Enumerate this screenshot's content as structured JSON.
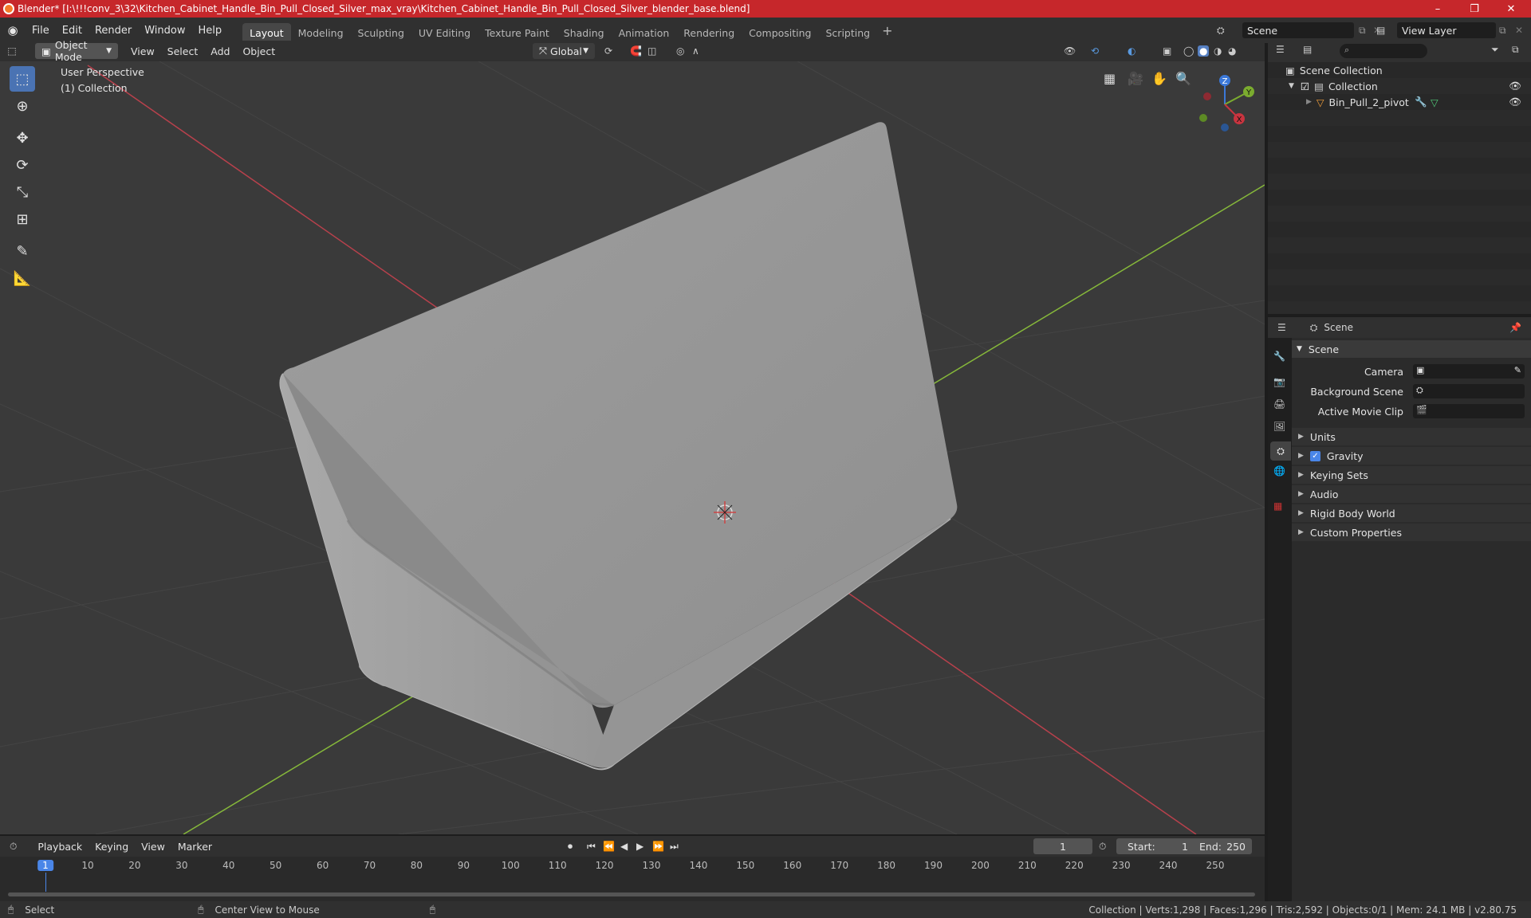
{
  "window": {
    "title": "Blender* [I:\\!!!conv_3\\32\\Kitchen_Cabinet_Handle_Bin_Pull_Closed_Silver_max_vray\\Kitchen_Cabinet_Handle_Bin_Pull_Closed_Silver_blender_base.blend]",
    "minimize": "–",
    "maximize": "❐",
    "close": "✕"
  },
  "menu": {
    "file": "File",
    "edit": "Edit",
    "render": "Render",
    "window": "Window",
    "help": "Help"
  },
  "workspaces": [
    "Layout",
    "Modeling",
    "Sculpting",
    "UV Editing",
    "Texture Paint",
    "Shading",
    "Animation",
    "Rendering",
    "Compositing",
    "Scripting"
  ],
  "workspace_add": "+",
  "scene_field": "Scene",
  "viewlayer_field": "View Layer",
  "viewport_header": {
    "mode": "Object Mode",
    "view": "View",
    "select": "Select",
    "add": "Add",
    "object": "Object",
    "orientation": "Global"
  },
  "viewport": {
    "perspective": "User Perspective",
    "collection": "(1) Collection",
    "gizmo": {
      "x": "X",
      "y": "Y",
      "z": "Z"
    },
    "colors": {
      "x_axis": "#b8414c",
      "y_axis": "#86b83a",
      "background": "#3a3a3a",
      "object": "#a6a6a6"
    }
  },
  "outliner": {
    "scene_collection": "Scene Collection",
    "collection": "Collection",
    "object": "Bin_Pull_2_pivot"
  },
  "properties": {
    "header": "Scene",
    "panel": "Scene",
    "camera_label": "Camera",
    "background_label": "Background Scene",
    "movieclip_label": "Active Movie Clip",
    "sections": [
      "Units",
      "Gravity",
      "Keying Sets",
      "Audio",
      "Rigid Body World",
      "Custom Properties"
    ]
  },
  "timeline": {
    "playback": "Playback",
    "keying": "Keying",
    "view": "View",
    "marker": "Marker",
    "current_frame": "1",
    "start_label": "Start:",
    "start": "1",
    "end_label": "End:",
    "end": "250",
    "ticks": [
      "1",
      "10",
      "20",
      "30",
      "40",
      "50",
      "60",
      "70",
      "80",
      "90",
      "100",
      "110",
      "120",
      "130",
      "140",
      "150",
      "160",
      "170",
      "180",
      "190",
      "200",
      "210",
      "220",
      "230",
      "240",
      "250"
    ]
  },
  "status": {
    "select": "Select",
    "center": "Center View to Mouse",
    "info": "Collection | Verts:1,298 | Faces:1,296 | Tris:2,592 | Objects:0/1 | Mem: 24.1 MB | v2.80.75"
  }
}
